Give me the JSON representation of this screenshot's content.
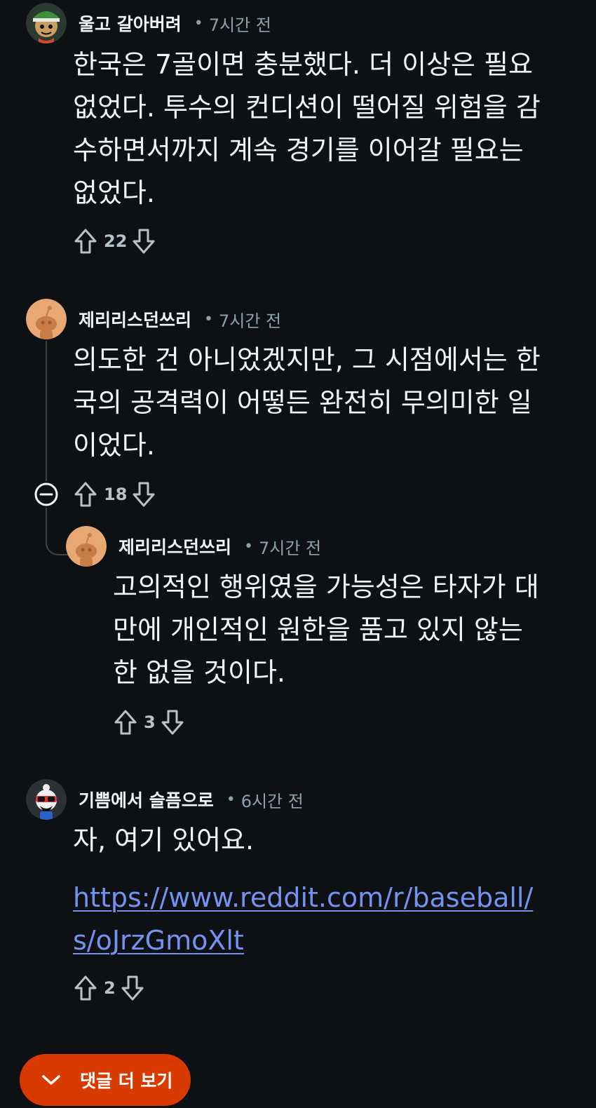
{
  "comments": [
    {
      "username": "울고 갈아버려",
      "time": "7시간 전",
      "lines": [
        "한국은 7골이면 충분했다. 더 이상은 필요",
        "없었다. 투수의 컨디션이 떨어질 위험을 감",
        "수하면서까지 계속 경기를 이어갈 필요는",
        "없었다."
      ],
      "votes": "22",
      "avatar": "snoo-green-hat-avatar"
    },
    {
      "username": "제리리스던쓰리",
      "time": "7시간 전",
      "lines": [
        "의도한 건 아니었겠지만, 그 시점에서는 한",
        "국의 공격력이 어떻든 완전히 무의미한 일",
        "이었다."
      ],
      "votes": "18",
      "avatar": "snoo-default-orange-avatar"
    },
    {
      "username": "제리리스던쓰리",
      "time": "7시간 전",
      "lines": [
        "고의적인 행위였을 가능성은 타자가 대",
        "만에 개인적인 원한을 품고 있지 않는",
        "한 없을 것이다."
      ],
      "votes": "3",
      "avatar": "snoo-default-orange-avatar"
    },
    {
      "username": "기쁨에서 슬픔으로",
      "time": "6시간 전",
      "lines": [
        "자, 여기 있어요."
      ],
      "link_lines": [
        "https://www.reddit.com/r/baseball/",
        "s/oJrzGmoXlt"
      ],
      "votes": "2",
      "avatar": "snoo-sunglasses-avatar"
    }
  ],
  "more_comments_label": "댓글 더 보기",
  "colors": {
    "background": "#0e1113",
    "text": "#f2f4f5",
    "meta": "#8ba2ad",
    "link": "#7592f0",
    "button": "#d93a00"
  },
  "icons": [
    "upvote-icon",
    "downvote-icon",
    "collapse-thread-icon",
    "chevron-down-icon"
  ]
}
